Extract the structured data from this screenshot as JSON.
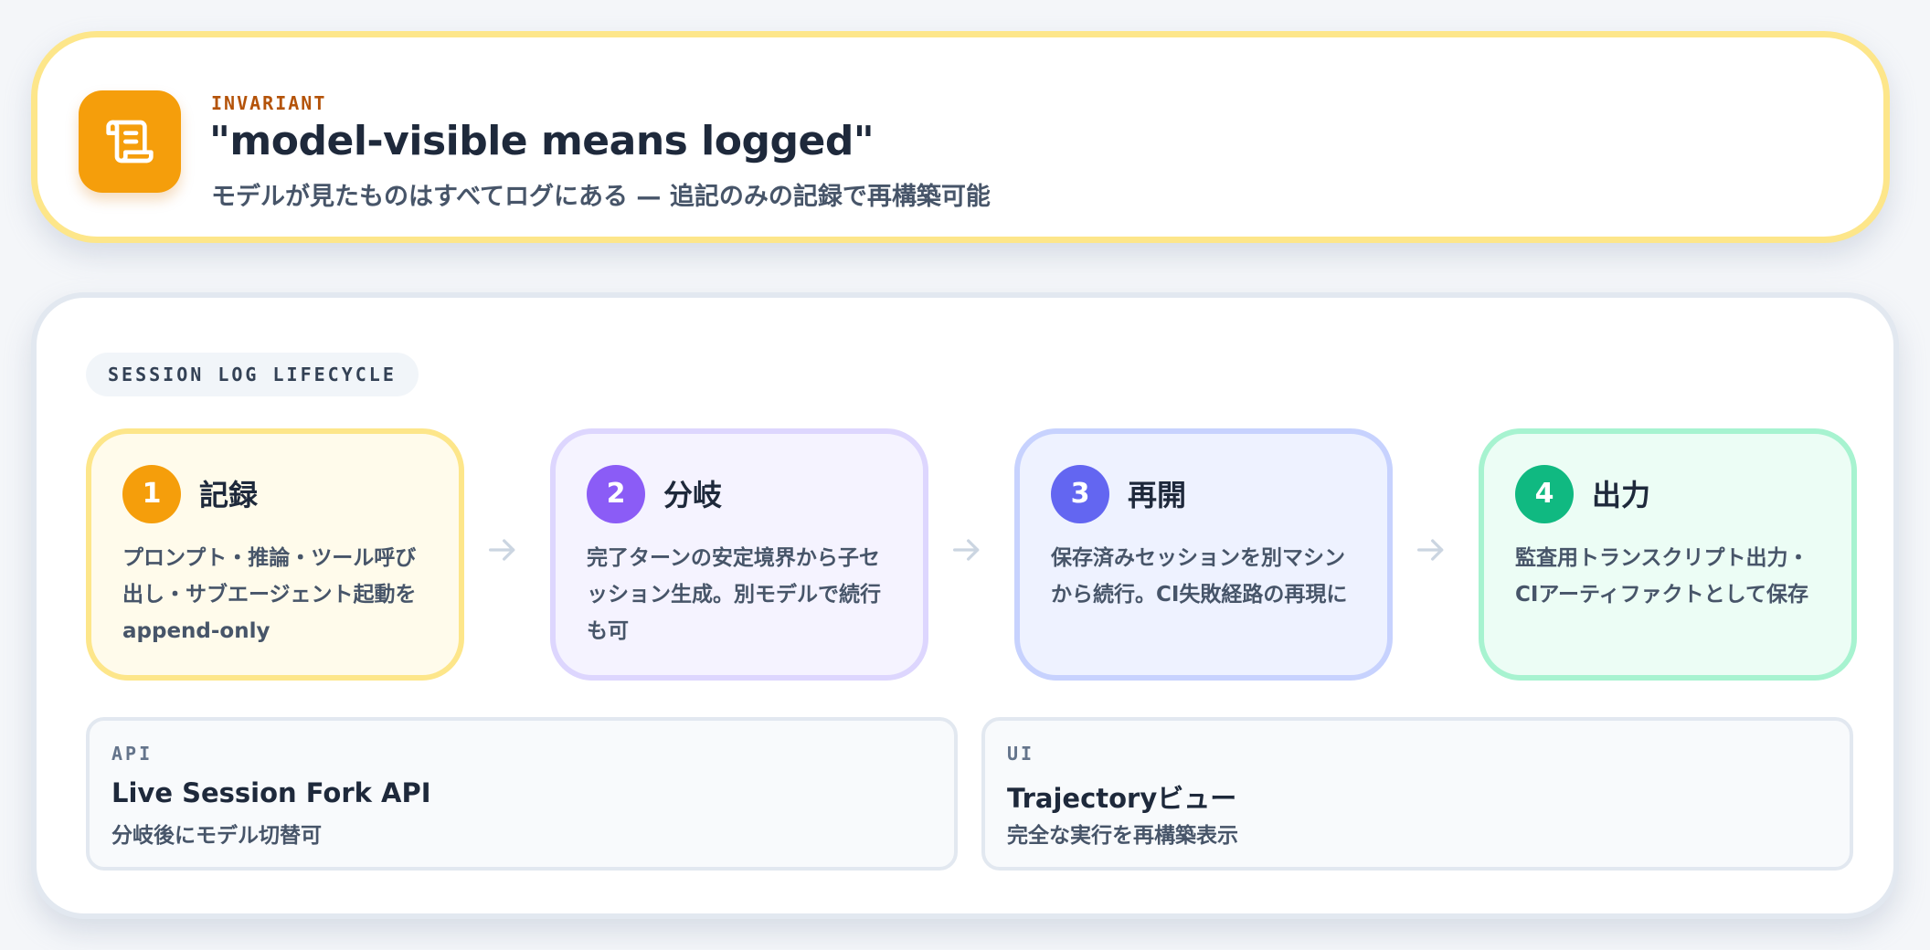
{
  "invariant": {
    "icon": "scroll-icon",
    "eyebrow": "INVARIANT",
    "title": "\"model-visible means logged\"",
    "subtitle": "モデルが見たものはすべてログにある — 追記のみの記録で再構築可能"
  },
  "lifecycle": {
    "section_label": "SESSION LOG LIFECYCLE",
    "steps": [
      {
        "number": "1",
        "title": "記録",
        "description": "プロンプト・推論・ツール呼び出し・サブエージェント起動をappend-only",
        "color": "#f59e0b"
      },
      {
        "number": "2",
        "title": "分岐",
        "description": "完了ターンの安定境界から子セッション生成。別モデルで続行も可",
        "color": "#8b5cf6"
      },
      {
        "number": "3",
        "title": "再開",
        "description": "保存済みセッションを別マシンから続行。CI失敗経路の再現に",
        "color": "#6366f1"
      },
      {
        "number": "4",
        "title": "出力",
        "description": "監査用トランスクリプト出力・CIアーティファクトとして保存",
        "color": "#10b981"
      }
    ],
    "arrow_icon": "arrow-right-icon",
    "cards": [
      {
        "eyebrow": "API",
        "title": "Live Session Fork API",
        "description": "分岐後にモデル切替可"
      },
      {
        "eyebrow": "UI",
        "title": "Trajectoryビュー",
        "description": "完全な実行を再構築表示"
      }
    ]
  }
}
